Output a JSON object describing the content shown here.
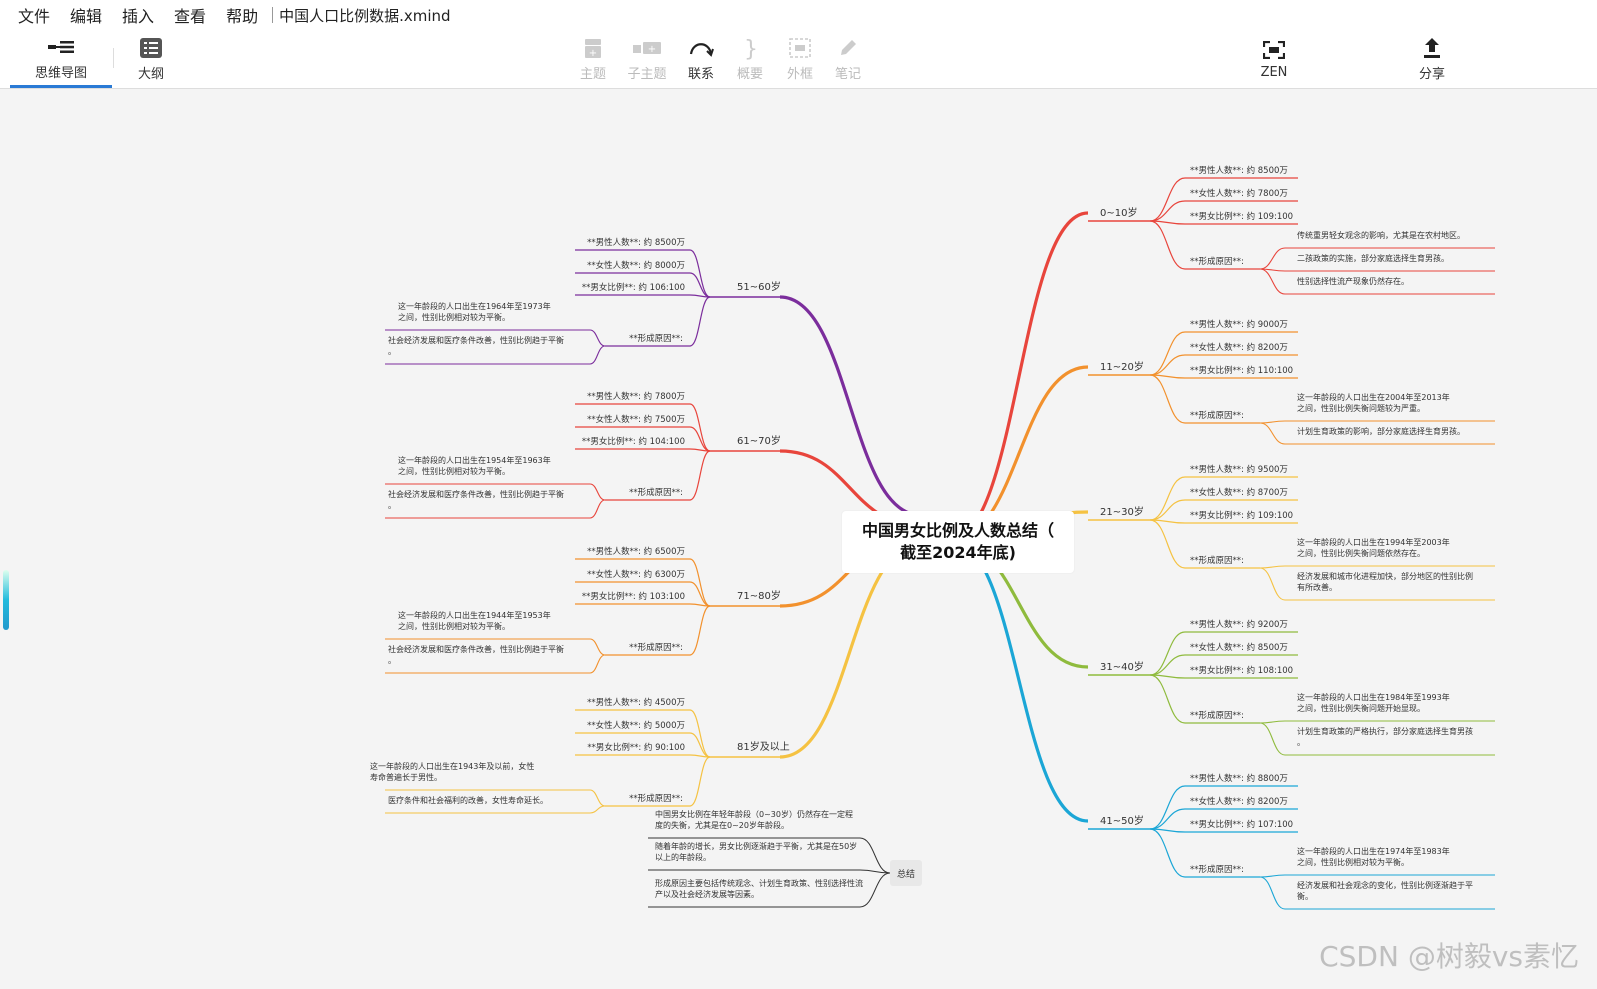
{
  "menu": {
    "items": [
      "文件",
      "编辑",
      "插入",
      "查看",
      "帮助"
    ],
    "file_title": "中国人口比例数据.xmind"
  },
  "toolbar": {
    "mindmap": "思维导图",
    "outline": "大纲",
    "topic": "主题",
    "subtopic": "子主题",
    "relationship": "联系",
    "summary": "概要",
    "boundary": "外框",
    "note": "笔记",
    "zen": "ZEN",
    "share": "分享"
  },
  "central": {
    "line1": "中国男女比例及人数总结（",
    "line2": "截至2024年底)"
  },
  "branches": [
    {
      "side": "right",
      "color": "#e8453c",
      "label": "0~10岁",
      "male": "**男性人数**: 约 8500万",
      "female": "**女性人数**: 约 7800万",
      "ratio": "**男女比例**: 约 109:100",
      "reason_label": "**形成原因**:",
      "reasons": [
        "传统重男轻女观念的影响，尤其是在农村地区。",
        "二孩政策的实施，部分家庭选择生育男孩。",
        "性别选择性流产现象仍然存在。"
      ]
    },
    {
      "side": "right",
      "color": "#f2912d",
      "label": "11~20岁",
      "male": "**男性人数**: 约 9000万",
      "female": "**女性人数**: 约 8200万",
      "ratio": "**男女比例**: 约 110:100",
      "reason_label": "**形成原因**:",
      "reasons": [
        "这一年龄段的人口出生在2004年至2013年之间，性别比例失衡问题较为严重。",
        "计划生育政策的影响，部分家庭选择生育男孩。"
      ]
    },
    {
      "side": "right",
      "color": "#f5c242",
      "label": "21~30岁",
      "male": "**男性人数**: 约 9500万",
      "female": "**女性人数**: 约 8700万",
      "ratio": "**男女比例**: 约 109:100",
      "reason_label": "**形成原因**:",
      "reasons": [
        "这一年龄段的人口出生在1994年至2003年之间，性别比例失衡问题依然存在。",
        "经济发展和城市化进程加快，部分地区的性别比例有所改善。"
      ]
    },
    {
      "side": "right",
      "color": "#8fbb3d",
      "label": "31~40岁",
      "male": "**男性人数**: 约 9200万",
      "female": "**女性人数**: 约 8500万",
      "ratio": "**男女比例**: 约 108:100",
      "reason_label": "**形成原因**:",
      "reasons": [
        "这一年龄段的人口出生在1984年至1993年之间，性别比例失衡问题开始显现。",
        "计划生育政策的严格执行，部分家庭选择生育男孩。"
      ]
    },
    {
      "side": "right",
      "color": "#1ba6d6",
      "label": "41~50岁",
      "male": "**男性人数**: 约 8800万",
      "female": "**女性人数**: 约 8200万",
      "ratio": "**男女比例**: 约 107:100",
      "reason_label": "**形成原因**:",
      "reasons": [
        "这一年龄段的人口出生在1974年至1983年之间，性别比例相对较为平衡。",
        "经济发展和社会观念的变化，性别比例逐渐趋于平衡。"
      ]
    },
    {
      "side": "left",
      "color": "#7b2d9c",
      "label": "51~60岁",
      "male": "**男性人数**: 约 8500万",
      "female": "**女性人数**: 约 8000万",
      "ratio": "**男女比例**: 约 106:100",
      "reason_label": "**形成原因**:",
      "reasons": [
        "这一年龄段的人口出生在1964年至1973年之间，性别比例相对较为平衡。",
        "社会经济发展和医疗条件改善，性别比例趋于平衡。"
      ]
    },
    {
      "side": "left",
      "color": "#e8453c",
      "label": "61~70岁",
      "male": "**男性人数**: 约 7800万",
      "female": "**女性人数**: 约 7500万",
      "ratio": "**男女比例**: 约 104:100",
      "reason_label": "**形成原因**:",
      "reasons": [
        "这一年龄段的人口出生在1954年至1963年之间，性别比例相对较为平衡。",
        "社会经济发展和医疗条件改善，性别比例趋于平衡。"
      ]
    },
    {
      "side": "left",
      "color": "#f2912d",
      "label": "71~80岁",
      "male": "**男性人数**: 约 6500万",
      "female": "**女性人数**: 约 6300万",
      "ratio": "**男女比例**: 约 103:100",
      "reason_label": "**形成原因**:",
      "reasons": [
        "这一年龄段的人口出生在1944年至1953年之间，性别比例相对较为平衡。",
        "社会经济发展和医疗条件改善，性别比例趋于平衡。"
      ]
    },
    {
      "side": "left",
      "color": "#f5c242",
      "label": "81岁及以上",
      "male": "**男性人数**: 约 4500万",
      "female": "**女性人数**: 约 5000万",
      "ratio": "**男女比例**: 约 90:100",
      "reason_label": "**形成原因**:",
      "reasons": [
        "这一年龄段的人口出生在1943年及以前，女性寿命普遍长于男性。",
        "医疗条件和社会福利的改善，女性寿命延长。"
      ]
    }
  ],
  "summary": {
    "label": "总结",
    "items": [
      "中国男女比例在年轻年龄段（0~30岁）仍然存在一定程度的失衡，尤其是在0~20岁年龄段。",
      "随着年龄的增长，男女比例逐渐趋于平衡，尤其是在50岁以上的年龄段。",
      "形成原因主要包括传统观念、计划生育政策、性别选择性流产以及社会经济发展等因素。"
    ]
  },
  "watermark": "CSDN @树毅vs素忆"
}
